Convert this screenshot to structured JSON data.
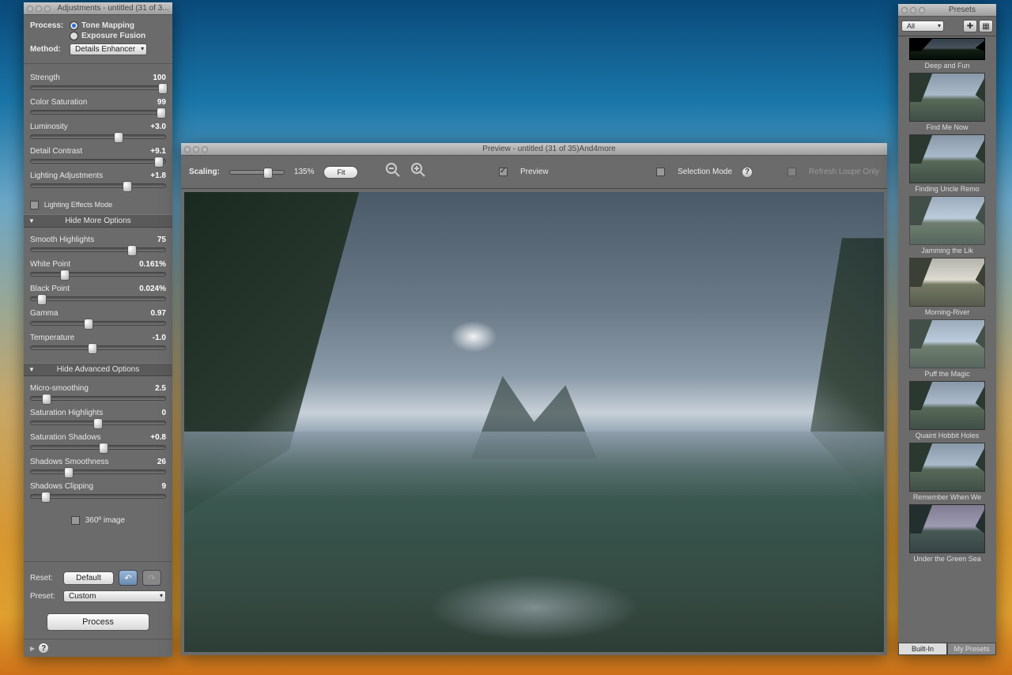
{
  "adjustments": {
    "title": "Adjustments - untitled (31 of 3...",
    "process_label": "Process:",
    "tone_mapping": "Tone Mapping",
    "exposure_fusion": "Exposure Fusion",
    "method_label": "Method:",
    "method_value": "Details Enhancer",
    "sliders1": [
      {
        "label": "Strength",
        "value": "100",
        "pos": 98
      },
      {
        "label": "Color Saturation",
        "value": "99",
        "pos": 97
      },
      {
        "label": "Luminosity",
        "value": "+3.0",
        "pos": 65
      },
      {
        "label": "Detail Contrast",
        "value": "+9.1",
        "pos": 95
      },
      {
        "label": "Lighting Adjustments",
        "value": "+1.8",
        "pos": 72
      }
    ],
    "lighting_effects": "Lighting Effects Mode",
    "hide_more": "Hide More Options",
    "sliders2": [
      {
        "label": "Smooth Highlights",
        "value": "75",
        "pos": 75
      },
      {
        "label": "White Point",
        "value": "0.161%",
        "pos": 25
      },
      {
        "label": "Black Point",
        "value": "0.024%",
        "pos": 8
      },
      {
        "label": "Gamma",
        "value": "0.97",
        "pos": 43
      },
      {
        "label": "Temperature",
        "value": "-1.0",
        "pos": 46
      }
    ],
    "hide_adv": "Hide Advanced Options",
    "sliders3": [
      {
        "label": "Micro-smoothing",
        "value": "2.5",
        "pos": 12
      },
      {
        "label": "Saturation Highlights",
        "value": "0",
        "pos": 50
      },
      {
        "label": "Saturation Shadows",
        "value": "+0.8",
        "pos": 54
      },
      {
        "label": "Shadows Smoothness",
        "value": "26",
        "pos": 28
      },
      {
        "label": "Shadows Clipping",
        "value": "9",
        "pos": 11
      }
    ],
    "image_360": "360º image",
    "reset_label": "Reset:",
    "default_btn": "Default",
    "preset_label": "Preset:",
    "preset_value": "Custom",
    "process_btn": "Process"
  },
  "preview": {
    "title": "Preview - untitled (31 of 35)And4more",
    "scaling_label": "Scaling:",
    "scaling_value": "135%",
    "fit_btn": "Fit",
    "preview_chk": "Preview",
    "selection_mode": "Selection Mode",
    "refresh_loupe": "Refresh Loupe Only"
  },
  "presets": {
    "title": "Presets",
    "filter": "All",
    "items": [
      {
        "label": "Deep and Fun",
        "cls": "dark"
      },
      {
        "label": "Find Me Now",
        "cls": ""
      },
      {
        "label": "Finding Uncle Remo",
        "cls": ""
      },
      {
        "label": "Jamming the Lik",
        "cls": "soft"
      },
      {
        "label": "Morning-River",
        "cls": "warm"
      },
      {
        "label": "Puff the Magic",
        "cls": "soft"
      },
      {
        "label": "Quaint Hobbit Holes",
        "cls": ""
      },
      {
        "label": "Remember When We",
        "cls": ""
      },
      {
        "label": "Under the Green Sea",
        "cls": "green"
      }
    ],
    "tab_builtin": "Built-In",
    "tab_my": "My Presets"
  }
}
